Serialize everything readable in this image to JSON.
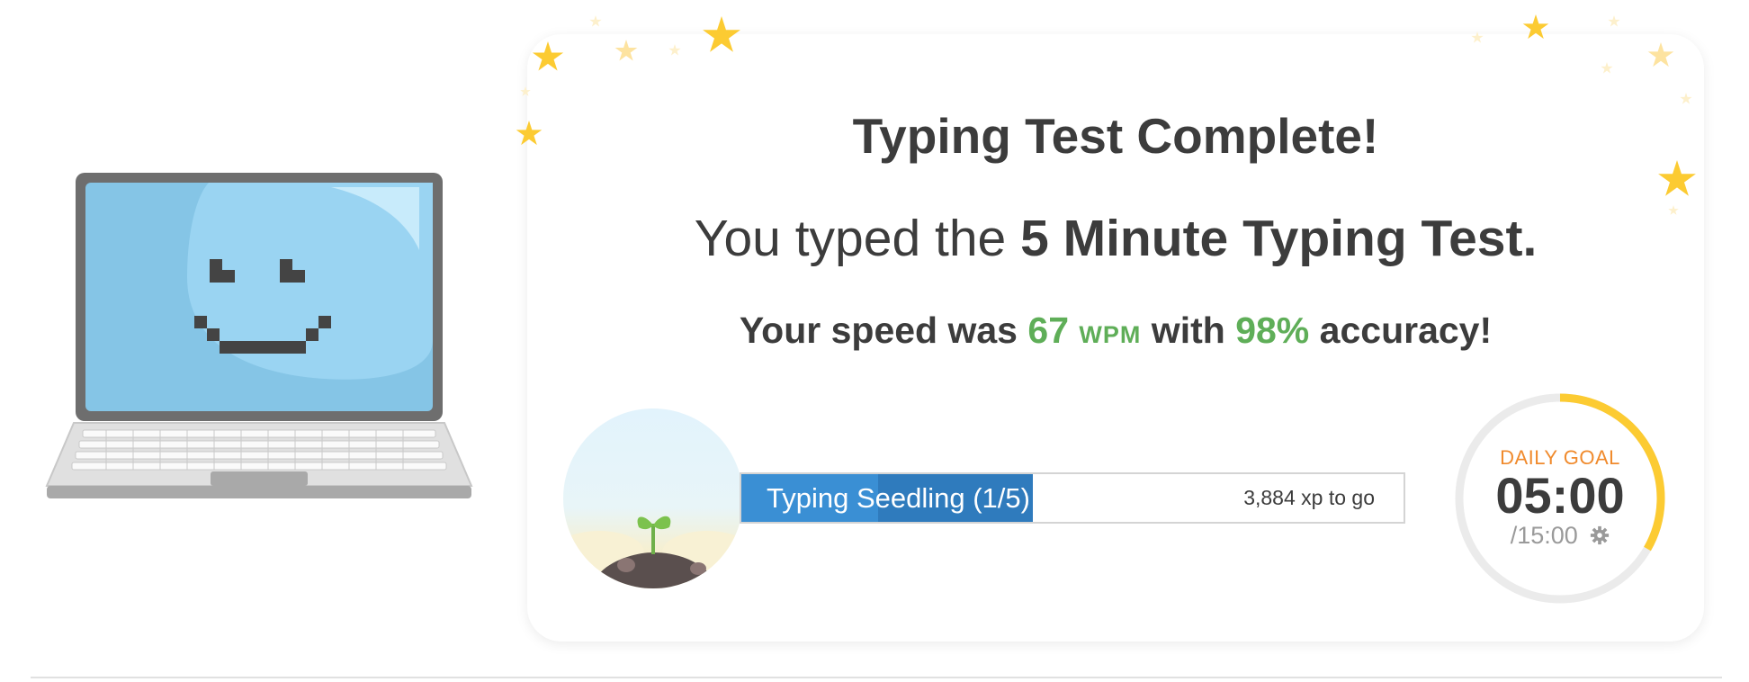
{
  "result": {
    "title": "Typing Test Complete!",
    "test_prefix": "You typed the",
    "test_name": "5 Minute Typing Test.",
    "speed_prefix": "Your speed was",
    "speed_value": "67",
    "speed_unit": "WPM",
    "speed_middle": "with",
    "accuracy_value": "98%",
    "accuracy_suffix": "accuracy!"
  },
  "progress": {
    "level_label": "Typing Seedling (1/5)",
    "xp_remaining": "3,884 xp to go",
    "fill_fraction": 0.44
  },
  "daily_goal": {
    "label": "DAILY GOAL",
    "time_done": "05:00",
    "time_total": "/15:00",
    "fraction_complete": 0.3333
  },
  "icons": {
    "mascot": "smiling-laptop-icon",
    "plant": "seedling-icon",
    "settings": "gear-icon",
    "decoration": "star-icon"
  },
  "colors": {
    "accent_green": "#5fae58",
    "progress_blue": "#3a8fd4",
    "goal_orange": "#f08a2c",
    "goal_ring": "#fccb32",
    "star": "#fccb32"
  }
}
